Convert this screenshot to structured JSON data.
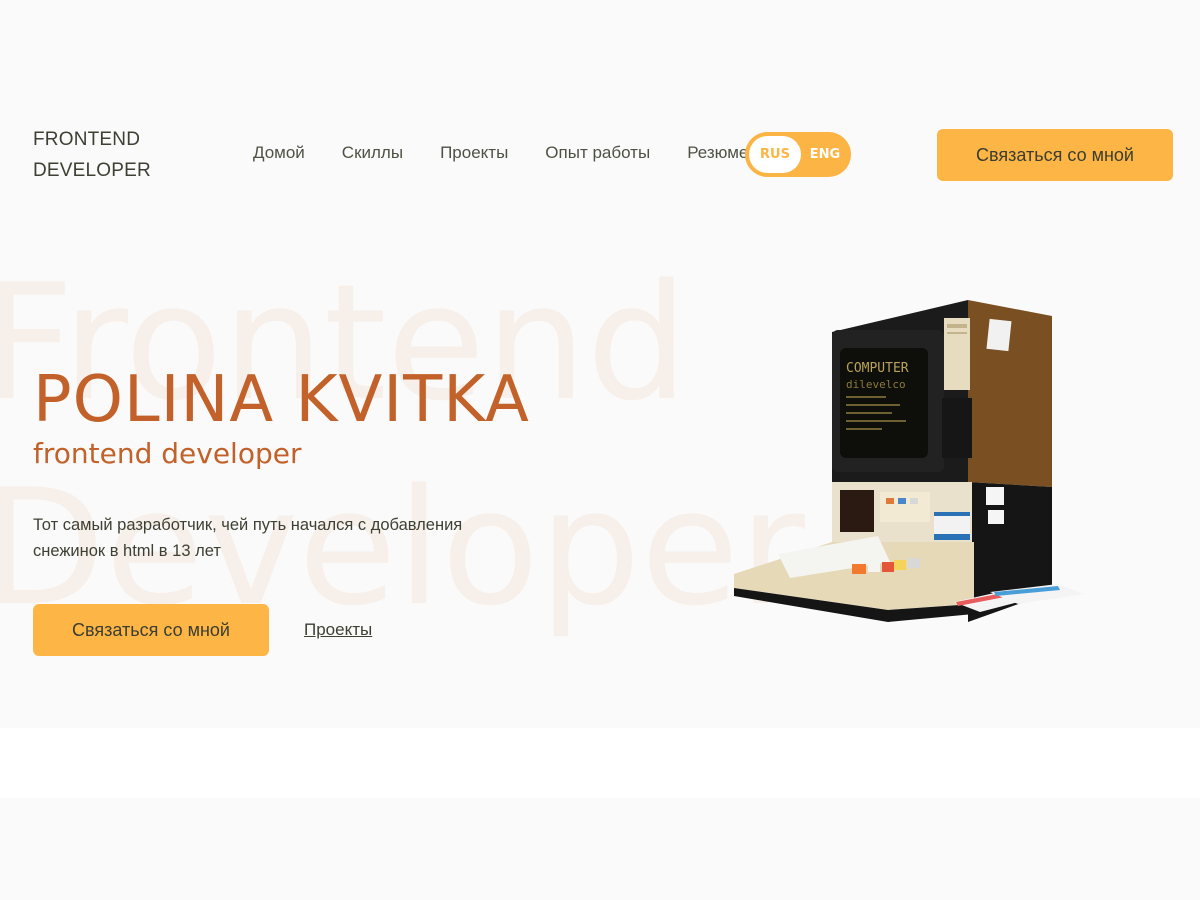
{
  "brand": {
    "line1": "FRONTEND",
    "line2": "DEVELOPER"
  },
  "nav": {
    "items": [
      "Домой",
      "Скиллы",
      "Проекты",
      "Опыт работы",
      "Резюме"
    ]
  },
  "lang": {
    "active": "RUS",
    "inactive": "ENG"
  },
  "header": {
    "cta_label": "Связаться со мной"
  },
  "watermark": {
    "line1": "Frontend",
    "line2": "Developer"
  },
  "hero": {
    "name": "POLINA KVITKA",
    "role": "frontend developer",
    "description": "Тот самый разработчик, чей путь начался с добавления снежинок в html в 13 лет",
    "cta_label": "Связаться со мной",
    "link_label": "Проекты"
  },
  "illustration": {
    "screen_line1": "COMPUTER",
    "screen_line2": "dilevelco"
  },
  "colors": {
    "accent": "#fdb646",
    "name": "#c2622a",
    "text": "#3d4032",
    "bg": "#fafafa"
  },
  "icons": [
    "retro-computer-illustration"
  ]
}
